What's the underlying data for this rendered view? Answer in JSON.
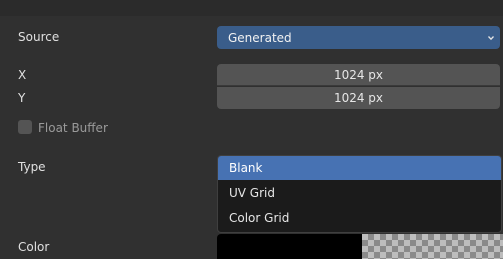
{
  "source": {
    "label": "Source",
    "value": "Generated",
    "dropdown_icon": "chevron-down-icon"
  },
  "size": {
    "x_label": "X",
    "x_value": "1024 px",
    "y_label": "Y",
    "y_value": "1024 px"
  },
  "float_buffer": {
    "label": "Float Buffer",
    "checked": false
  },
  "type": {
    "label": "Type",
    "options": [
      "Blank",
      "UV Grid",
      "Color Grid"
    ],
    "selected": "Blank"
  },
  "color": {
    "label": "Color",
    "value": "#000000"
  },
  "colors": {
    "accent": "#4772b3",
    "panel_bg": "#303030",
    "field_bg": "#545454",
    "menu_bg": "#1b1b1b"
  }
}
